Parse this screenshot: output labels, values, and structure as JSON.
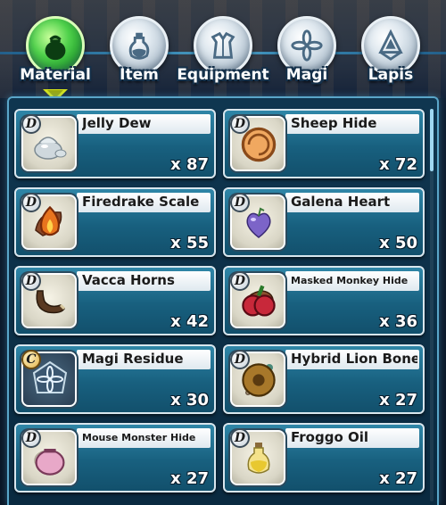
{
  "tabs": [
    {
      "label": "Material",
      "icon": "bag-icon",
      "active": true
    },
    {
      "label": "Item",
      "icon": "potion-icon",
      "active": false
    },
    {
      "label": "Equipment",
      "icon": "armor-icon",
      "active": false
    },
    {
      "label": "Magi",
      "icon": "magi-flower-icon",
      "active": false
    },
    {
      "label": "Lapis",
      "icon": "crystal-icon",
      "active": false
    }
  ],
  "items": [
    {
      "name": "Jelly Dew",
      "qty": "x 87",
      "rank": "D",
      "icon": "jelly-dew-icon"
    },
    {
      "name": "Sheep Hide",
      "qty": "x 72",
      "rank": "D",
      "icon": "sheep-hide-icon",
      "badge": "shell-badge-icon"
    },
    {
      "name": "Firedrake Scale",
      "qty": "x 55",
      "rank": "D",
      "icon": "firedrake-scale-icon",
      "badge": "flame-badge-icon"
    },
    {
      "name": "Galena Heart",
      "qty": "x 50",
      "rank": "D",
      "icon": "galena-heart-icon"
    },
    {
      "name": "Vacca Horns",
      "qty": "x 42",
      "rank": "D",
      "icon": "vacca-horn-icon"
    },
    {
      "name": "Masked Monkey Hide",
      "qty": "x 36",
      "rank": "D",
      "icon": "monkey-hide-icon",
      "badge": "berry-badge-icon"
    },
    {
      "name": "Magi Residue",
      "qty": "x 30",
      "rank": "C",
      "icon": "magi-residue-icon"
    },
    {
      "name": "Hybrid Lion Bone",
      "qty": "x 27",
      "rank": "D",
      "icon": "lion-bone-icon",
      "badge": "flower-badge-icon"
    },
    {
      "name": "Mouse Monster Hide",
      "qty": "x 27",
      "rank": "D",
      "icon": "mouse-hide-icon",
      "badge": "pouch-badge-icon"
    },
    {
      "name": "Froggo Oil",
      "qty": "x 27",
      "rank": "D",
      "icon": "froggo-oil-icon"
    }
  ]
}
